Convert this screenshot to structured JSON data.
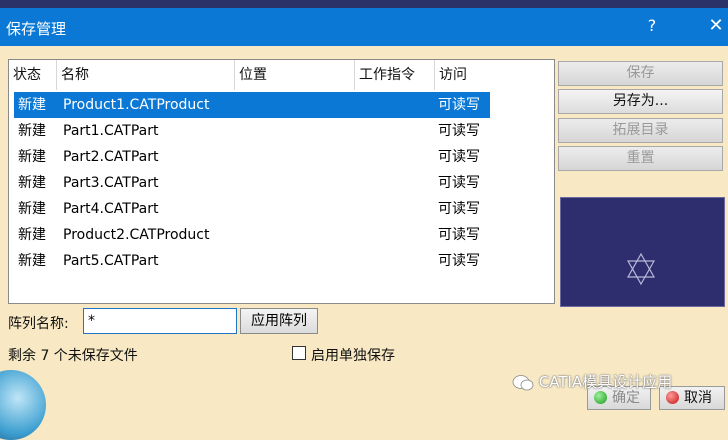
{
  "window": {
    "title": "保存管理",
    "help": "?",
    "close": "✕"
  },
  "table": {
    "headers": {
      "status": "状态",
      "name": "名称",
      "location": "位置",
      "work_instruction": "工作指令",
      "access": "访问"
    },
    "rows": [
      {
        "status": "新建",
        "name": "Product1.CATProduct",
        "access": "可读写"
      },
      {
        "status": "新建",
        "name": "Part1.CATPart",
        "access": "可读写"
      },
      {
        "status": "新建",
        "name": "Part2.CATPart",
        "access": "可读写"
      },
      {
        "status": "新建",
        "name": "Part3.CATPart",
        "access": "可读写"
      },
      {
        "status": "新建",
        "name": "Part4.CATPart",
        "access": "可读写"
      },
      {
        "status": "新建",
        "name": "Product2.CATProduct",
        "access": "可读写"
      },
      {
        "status": "新建",
        "name": "Part5.CATPart",
        "access": "可读写"
      }
    ]
  },
  "side_buttons": {
    "save": "保存",
    "save_as": "另存为...",
    "expand_dir": "拓展目录",
    "reset": "重置"
  },
  "array": {
    "label": "阵列名称:",
    "value": "*",
    "apply": "应用阵列"
  },
  "status": {
    "remaining": "剩余 7 个未保存文件",
    "separate_save": "启用单独保存"
  },
  "footer": {
    "ok": "确定",
    "cancel": "取消"
  },
  "watermark": {
    "text": "CATIA模具设计应用"
  },
  "colors": {
    "selection": "#0a78d4",
    "dialog_bg": "#f8e9c4",
    "preview_bg": "#2e2e6e"
  }
}
